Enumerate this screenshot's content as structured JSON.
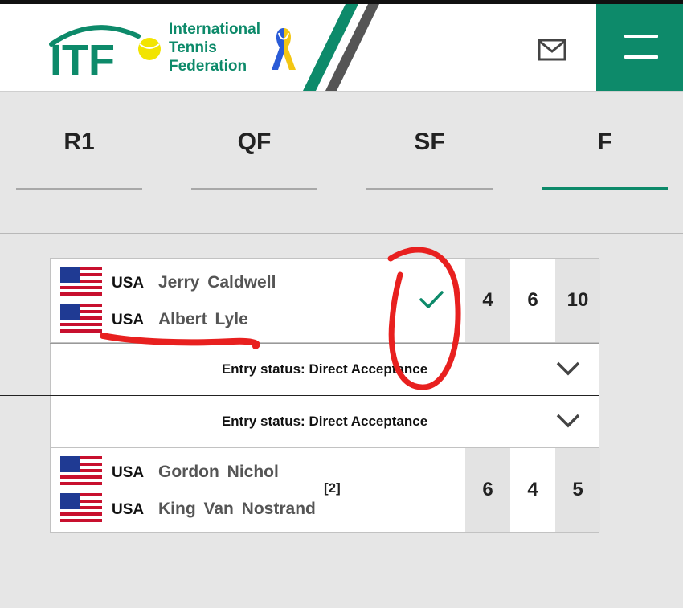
{
  "header": {
    "logo_text": "ITF",
    "org_line1": "International",
    "org_line2": "Tennis",
    "org_line3": "Federation",
    "colors": {
      "brand": "#0d8a6a",
      "ribbon_blue": "#2a5bd7",
      "ribbon_yellow": "#f3c613"
    }
  },
  "tabs": [
    {
      "label": "R1"
    },
    {
      "label": "QF"
    },
    {
      "label": "SF"
    },
    {
      "label": "F",
      "active": true
    }
  ],
  "match1": {
    "players": [
      {
        "country": "USA",
        "name": "Jerry Caldwell"
      },
      {
        "country": "USA",
        "name": "Albert Lyle"
      }
    ],
    "winner_icon": "check-icon",
    "scores": [
      "4",
      "6",
      "10"
    ]
  },
  "entry1": {
    "status": "Entry status: Direct Acceptance"
  },
  "entry2": {
    "status": "Entry status: Direct Acceptance"
  },
  "match2": {
    "players": [
      {
        "country": "USA",
        "name": "Gordon Nichol"
      },
      {
        "country": "USA",
        "name": "King Van Nostrand"
      }
    ],
    "seed": "[2]",
    "scores": [
      "6",
      "4",
      "5"
    ]
  }
}
